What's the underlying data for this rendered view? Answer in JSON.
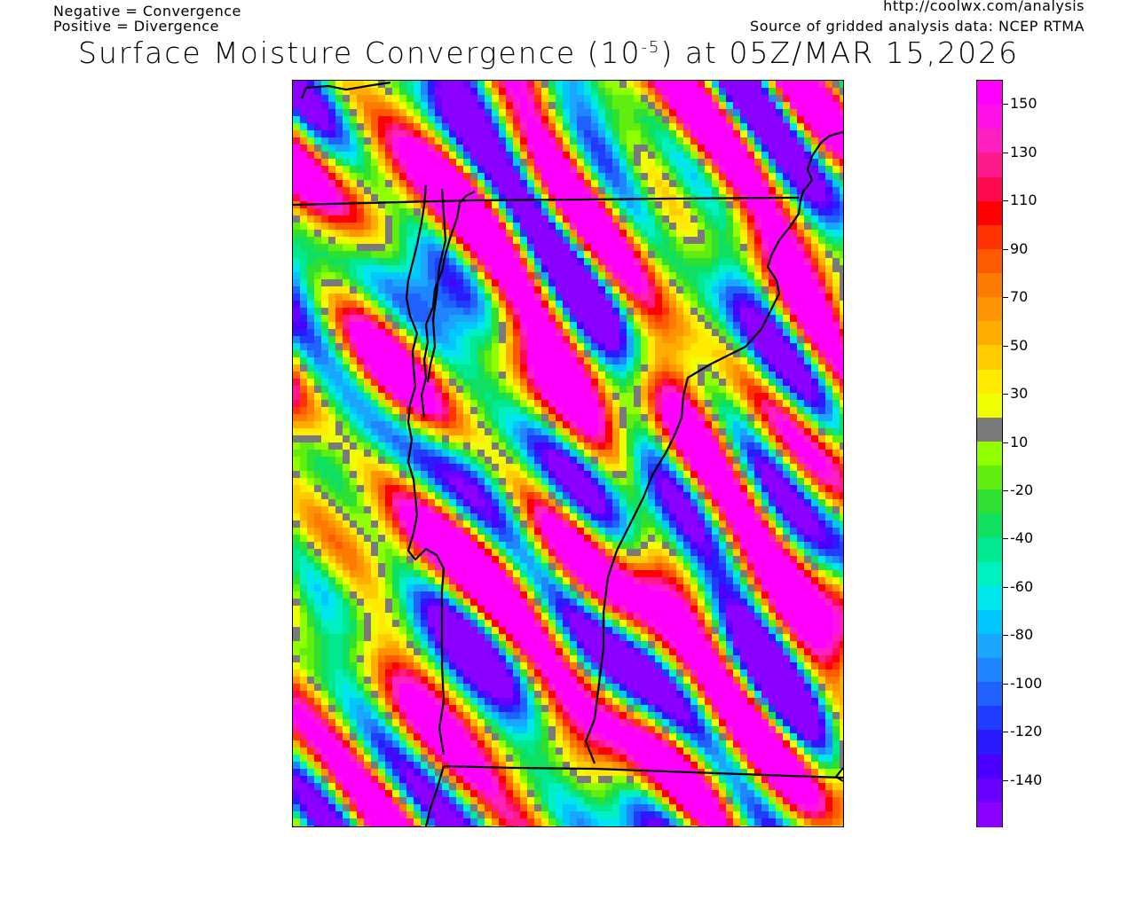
{
  "header": {
    "note_negative": "Negative = Convergence",
    "note_positive": "Positive = Divergence",
    "url": "http://coolwx.com/analysis",
    "source": "Source of gridded analysis data:  NCEP RTMA",
    "title_prefix": "Surface Moisture Convergence (10",
    "title_exponent": "-5",
    "title_suffix": ") at 05Z/MAR 15,2026"
  },
  "colorbar": {
    "colors": [
      "#8b00ff",
      "#6a00ff",
      "#4b00ff",
      "#2a1bff",
      "#1f3cff",
      "#1f62ff",
      "#1e86ff",
      "#1aa6ff",
      "#00c8ff",
      "#00e6ee",
      "#00f0c0",
      "#00e890",
      "#10e060",
      "#30e030",
      "#60ee10",
      "#90ff00",
      "#7a7a7a",
      "#f0ff00",
      "#ffea00",
      "#ffcc00",
      "#ffae00",
      "#ff9400",
      "#ff7a00",
      "#ff5a00",
      "#ff3300",
      "#ff0000",
      "#ff0a50",
      "#ff1a8c",
      "#ff20c0",
      "#ff10e8",
      "#ff00ff"
    ],
    "labels": [
      "150",
      "130",
      "110",
      "90",
      "70",
      "50",
      "30",
      "10",
      "-20",
      "-40",
      "-60",
      "-80",
      "-100",
      "-120",
      "-140"
    ]
  }
}
